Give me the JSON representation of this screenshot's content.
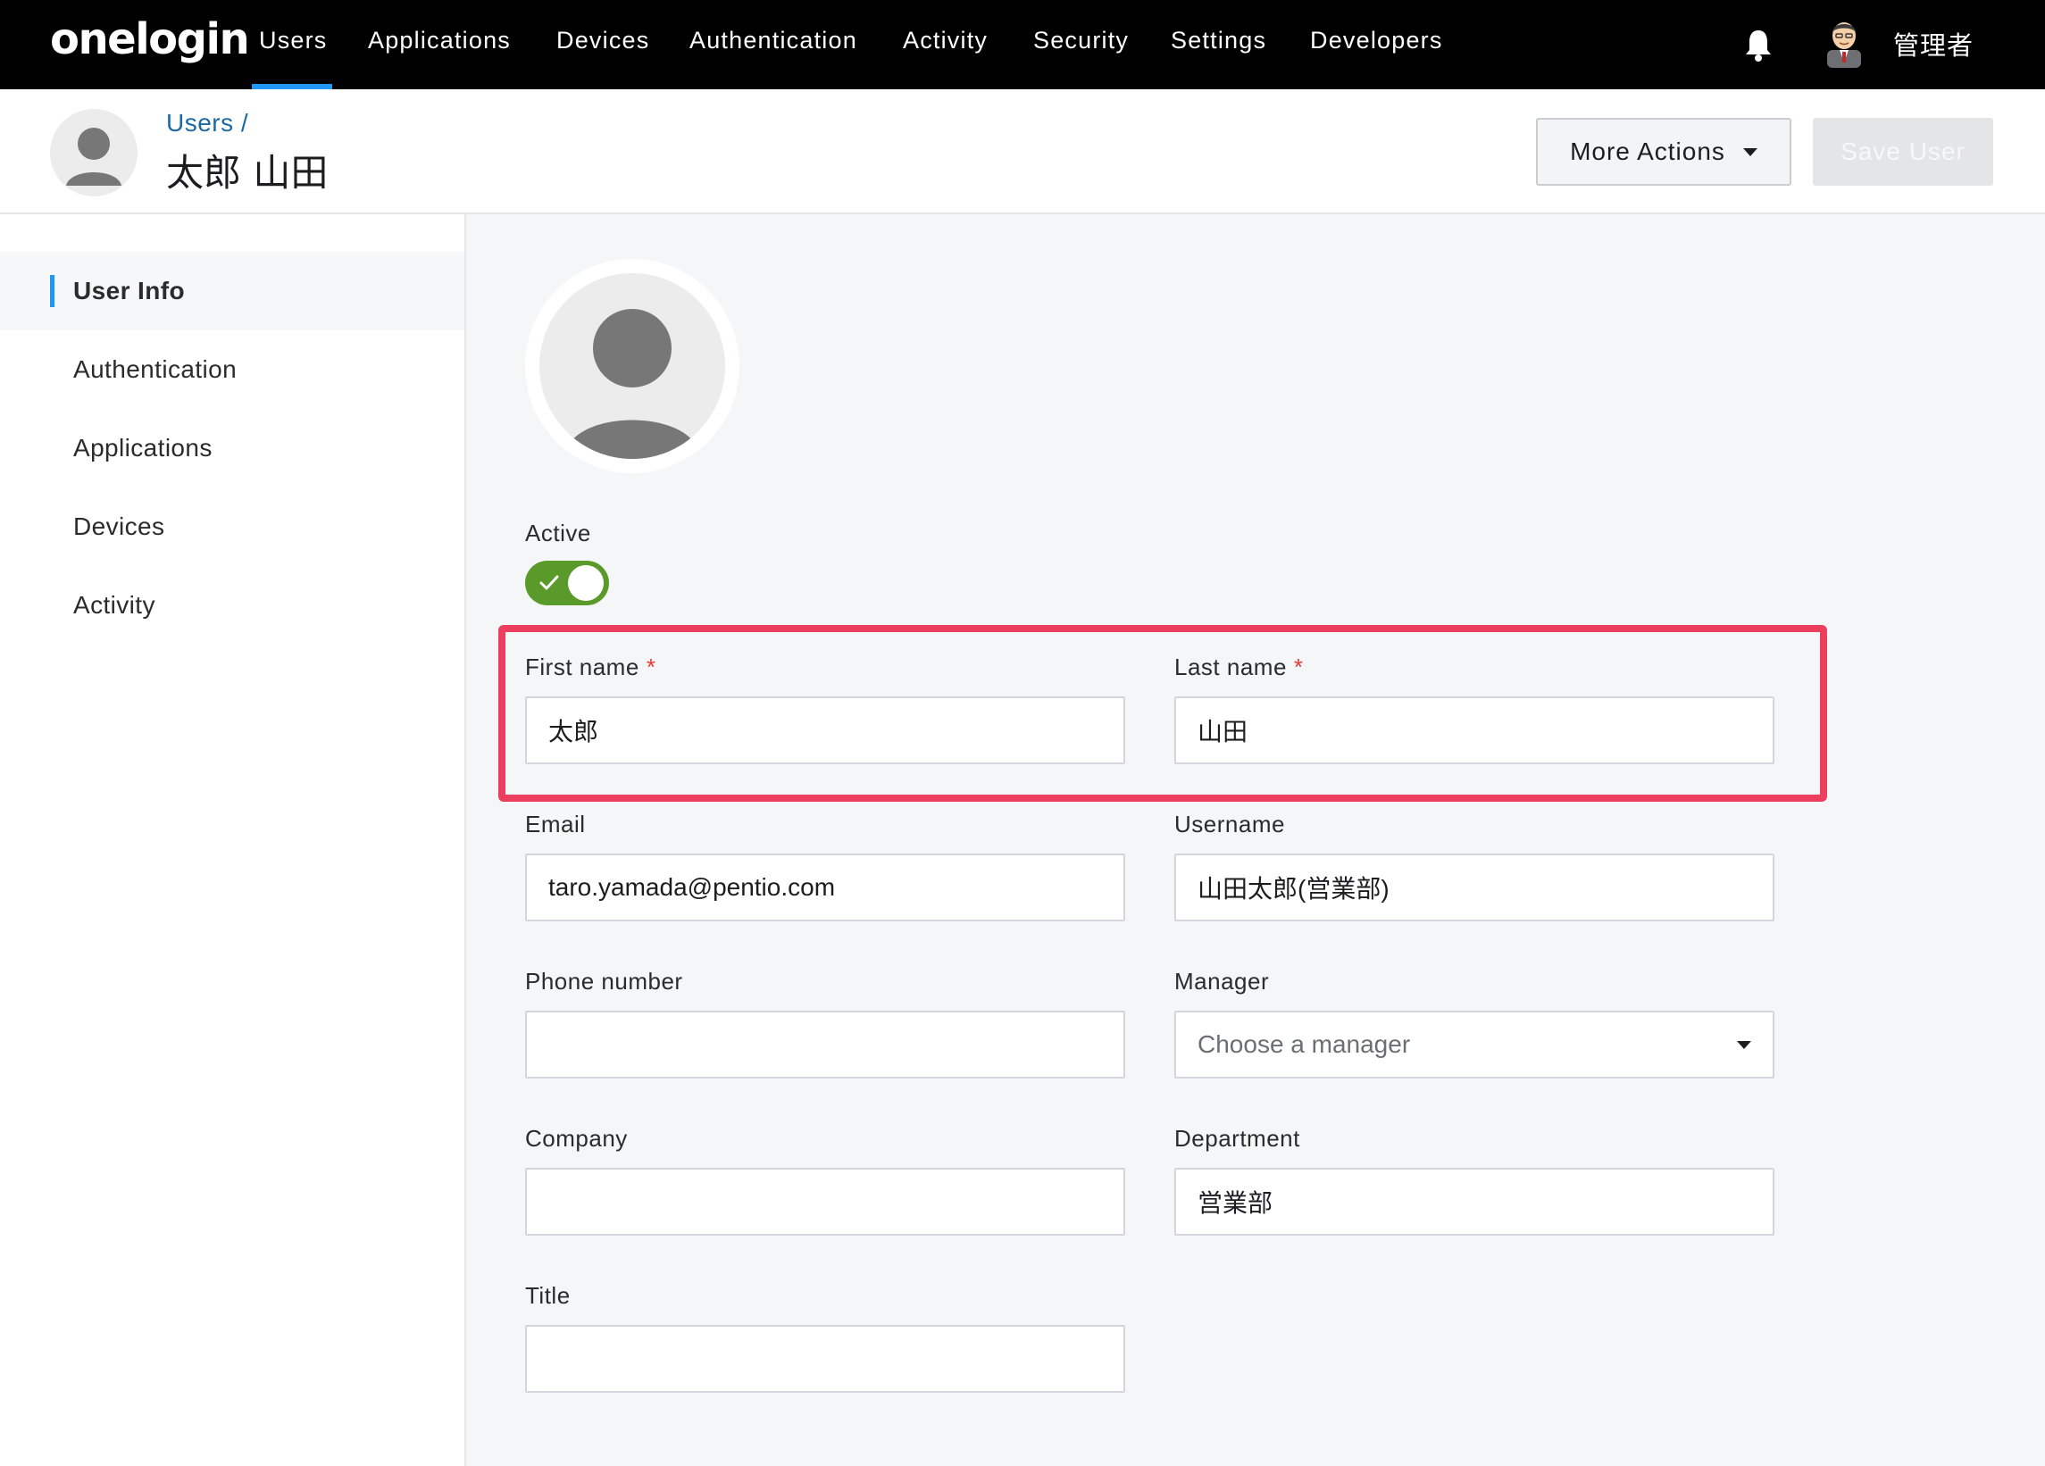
{
  "brand": {
    "logo_text": "onelogin"
  },
  "nav": {
    "items": [
      "Users",
      "Applications",
      "Devices",
      "Authentication",
      "Activity",
      "Security",
      "Settings",
      "Developers"
    ],
    "active": "Users",
    "accent_color": "#2196f3"
  },
  "header_right": {
    "bell_icon": "bell-icon",
    "admin_name": "管理者"
  },
  "page": {
    "breadcrumb": "Users /",
    "title": "太郎 山田",
    "more_actions_label": "More Actions",
    "save_label": "Save User"
  },
  "sidebar": {
    "items": [
      {
        "label": "User Info",
        "active": true
      },
      {
        "label": "Authentication",
        "active": false
      },
      {
        "label": "Applications",
        "active": false
      },
      {
        "label": "Devices",
        "active": false
      },
      {
        "label": "Activity",
        "active": false
      }
    ]
  },
  "form": {
    "active_label": "Active",
    "active_value": true,
    "toggle_color": "#5a9a2a",
    "first_name": {
      "label": "First name",
      "required_mark": "*",
      "value": "太郎"
    },
    "last_name": {
      "label": "Last name",
      "required_mark": "*",
      "value": "山田"
    },
    "email": {
      "label": "Email",
      "value": "taro.yamada@pentio.com"
    },
    "username": {
      "label": "Username",
      "value": "山田太郎(営業部)"
    },
    "phone": {
      "label": "Phone number",
      "value": ""
    },
    "manager": {
      "label": "Manager",
      "placeholder": "Choose a manager"
    },
    "company": {
      "label": "Company",
      "value": ""
    },
    "department": {
      "label": "Department",
      "value": "営業部"
    },
    "title": {
      "label": "Title",
      "value": ""
    }
  },
  "highlight": {
    "color": "#ec3f5f",
    "target": "name-fields"
  }
}
